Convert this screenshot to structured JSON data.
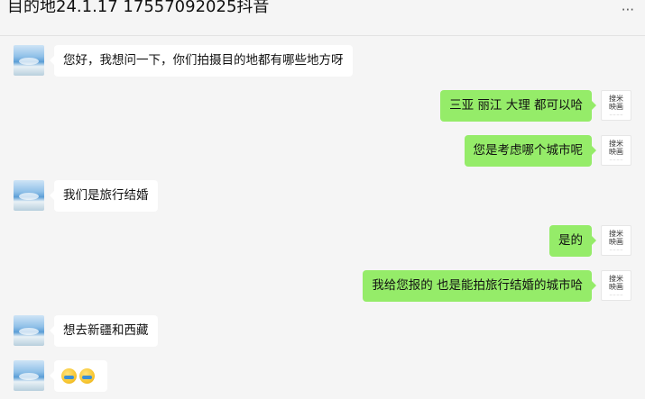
{
  "header": {
    "title": "目的地24.1.17 17557092025抖音",
    "more_icon": "more-dots-icon",
    "more_text": "···"
  },
  "studio_avatar": {
    "logo_text": "搜米映画",
    "sub_text": "— — — —"
  },
  "messages": [
    {
      "side": "left",
      "text": "您好，我想问一下，你们拍摄目的地都有哪些地方呀"
    },
    {
      "side": "right",
      "text": "三亚 丽江 大理 都可以哈"
    },
    {
      "side": "right",
      "text": "您是考虑哪个城市呢"
    },
    {
      "side": "left",
      "text": "我们是旅行结婚"
    },
    {
      "side": "right",
      "text": "是的"
    },
    {
      "side": "right",
      "text": "我给您报的 也是能拍旅行结婚的城市哈"
    },
    {
      "side": "left",
      "text": "想去新疆和西藏"
    },
    {
      "side": "left",
      "emojis": [
        "laugh-cry-emoji",
        "laugh-cry-emoji"
      ]
    }
  ],
  "colors": {
    "background": "#f5f5f5",
    "left_bubble": "#ffffff",
    "right_bubble": "#95ec69"
  }
}
